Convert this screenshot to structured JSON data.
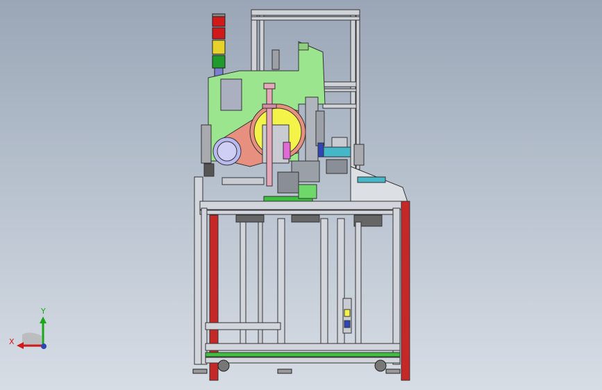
{
  "triad": {
    "x_label": "X",
    "y_label": "Y"
  },
  "colors": {
    "background_top": "#9aa6b6",
    "background_bottom": "#d7dde5",
    "frame": "#c8ccd2",
    "frame_edge": "#3a3a3a",
    "leg_red": "#c62828",
    "guard_green": "#9be58f",
    "salmon": "#e8907f",
    "yellow": "#f3f34a",
    "pink": "#e6a7b8",
    "lavender": "#b9b9f2",
    "magenta": "#e26ad6",
    "base_green": "#3fbf3f",
    "tower_red": "#d11919",
    "tower_yellow": "#e6d22a",
    "tower_green": "#1e9b2a",
    "cyan": "#46b6c9",
    "blue_part": "#2f45b8"
  },
  "model": {
    "view": "front",
    "signal_tower_segments": [
      "red",
      "red",
      "yellow",
      "green"
    ]
  }
}
